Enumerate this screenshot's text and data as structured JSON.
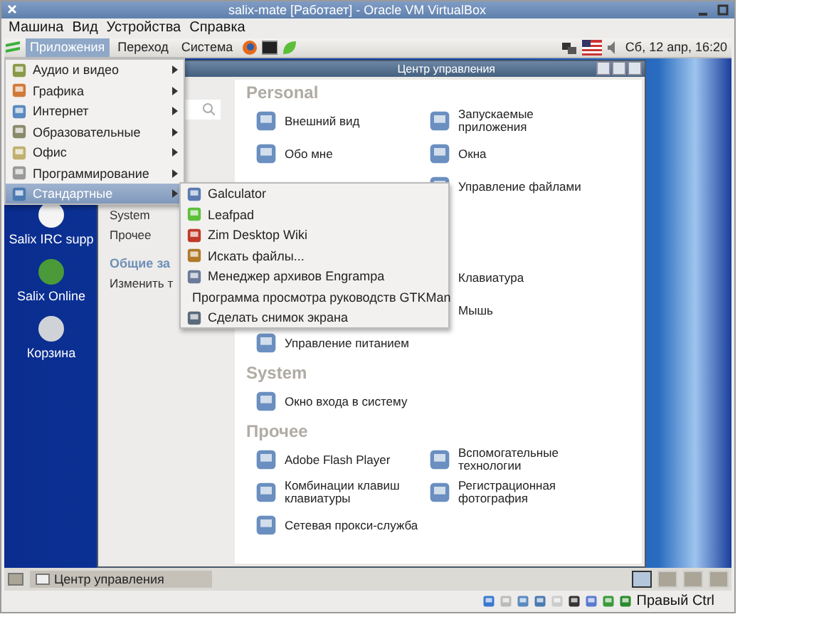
{
  "window": {
    "title": "salix-mate [Работает] - Oracle VM VirtualBox"
  },
  "menubar": [
    "Машина",
    "Вид",
    "Устройства",
    "Справка"
  ],
  "top_panel": {
    "menus": [
      {
        "label": "Приложения",
        "selected": true
      },
      {
        "label": "Переход",
        "selected": false
      },
      {
        "label": "Система",
        "selected": false
      }
    ],
    "clock": "Сб, 12 апр, 16:20"
  },
  "desktop_icons": [
    {
      "label": "Salix IRC supp"
    },
    {
      "label": "Salix Online"
    },
    {
      "label": "Корзина"
    }
  ],
  "control_center": {
    "title": "Центр управления",
    "sidebar": [
      {
        "label": "System",
        "kind": "item"
      },
      {
        "label": "Прочее",
        "kind": "item"
      },
      {
        "label": "Общие за",
        "kind": "heading"
      },
      {
        "label": "Изменить т",
        "kind": "item"
      }
    ],
    "sections": [
      {
        "title": "Personal",
        "rows": [
          {
            "left": "Внешний вид",
            "right": "Запускаемые приложения"
          },
          {
            "left": "Обо мне",
            "right": "Окна"
          },
          {
            "right": "Управление файлами"
          }
        ]
      },
      {
        "rows": [
          {
            "right": "Клавиатура"
          },
          {
            "right": "Мышь"
          },
          {
            "left": "Управление питанием"
          }
        ]
      },
      {
        "title": "System",
        "rows": [
          {
            "left": "Окно входа в систему"
          }
        ]
      },
      {
        "title": "Прочее",
        "rows": [
          {
            "left": "Adobe Flash Player",
            "right": "Вспомогательные технологии"
          },
          {
            "left": "Комбинации клавиш клавиатуры",
            "right": "Регистрационная фотография"
          },
          {
            "left": "Сетевая прокси-служба"
          }
        ]
      }
    ]
  },
  "apps_menu": [
    {
      "label": "Аудио и видео",
      "selected": false
    },
    {
      "label": "Графика",
      "selected": false
    },
    {
      "label": "Интернет",
      "selected": false
    },
    {
      "label": "Образовательные",
      "selected": false
    },
    {
      "label": "Офис",
      "selected": false
    },
    {
      "label": "Программирование",
      "selected": false
    },
    {
      "label": "Стандартные",
      "selected": true
    }
  ],
  "submenu": [
    "Galculator",
    "Leafpad",
    "Zim Desktop Wiki",
    "Искать файлы...",
    "Менеджер архивов Engrampa",
    "Программа просмотра руководств GTKMan",
    "Сделать снимок экрана"
  ],
  "bottom_panel": {
    "task": "Центр управления",
    "workspaces": [
      {
        "selected": true
      },
      {
        "selected": false
      },
      {
        "selected": false
      },
      {
        "selected": false
      }
    ]
  },
  "status_bar": {
    "host_key": "Правый Ctrl"
  }
}
